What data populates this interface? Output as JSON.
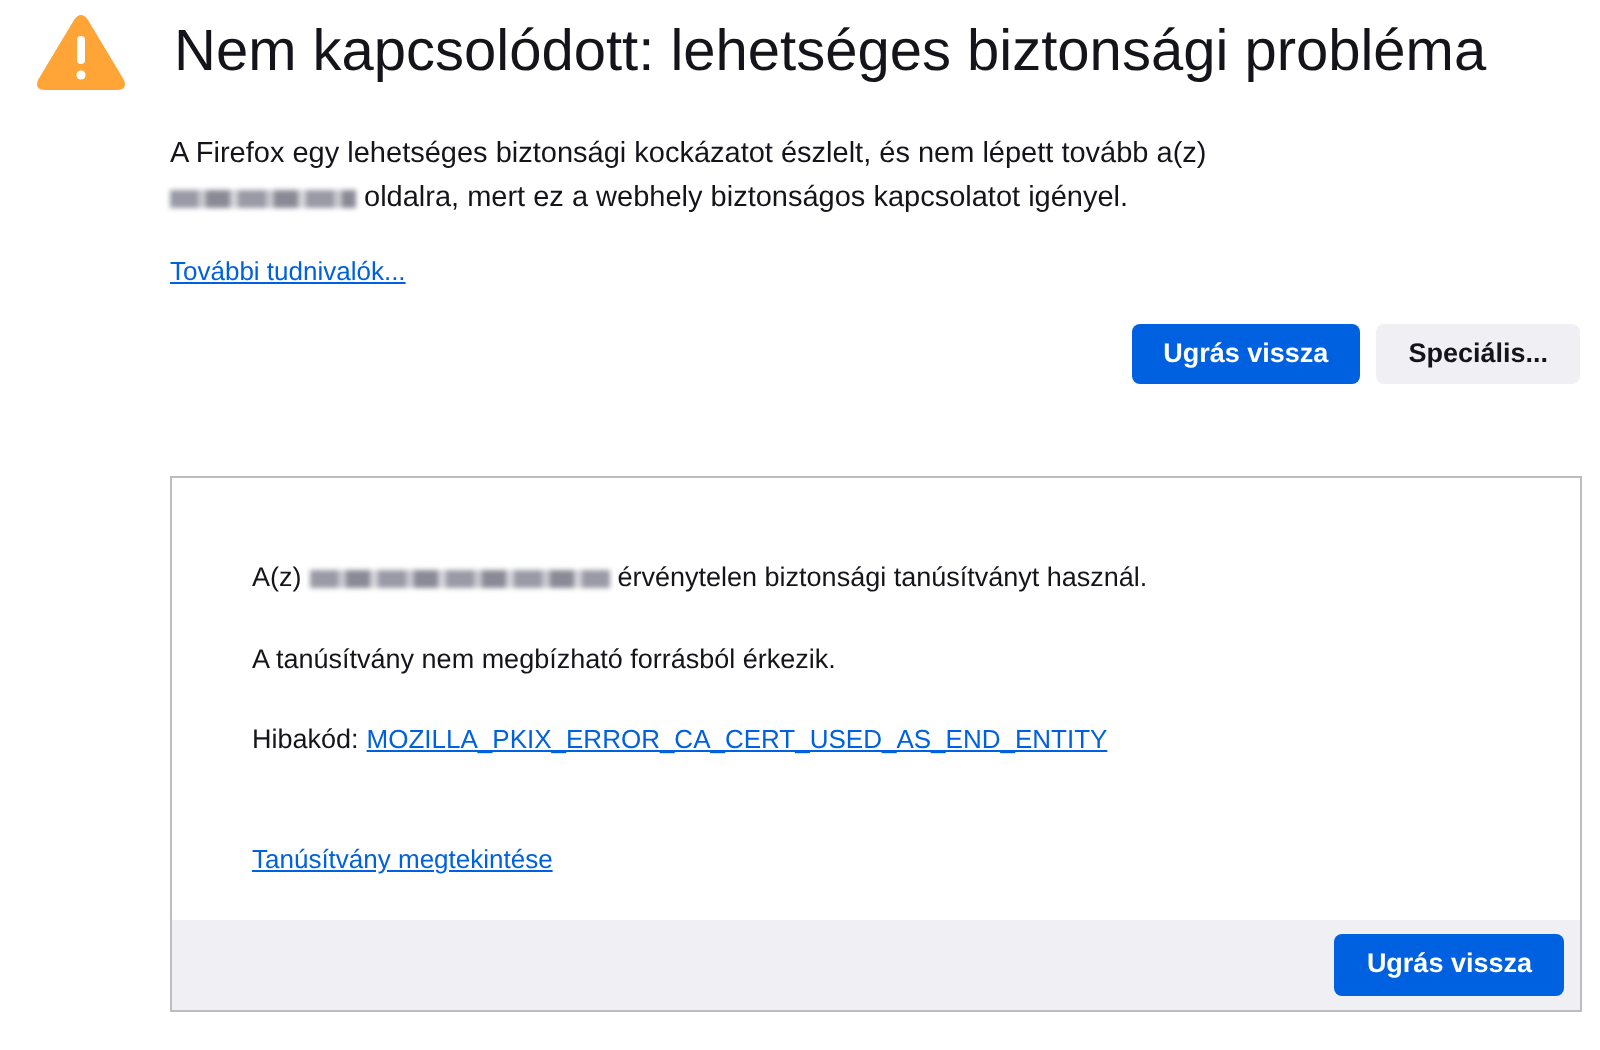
{
  "title": "Nem kapcsolódott: lehetséges biztonsági probléma",
  "intro": {
    "line_1": "A Firefox egy lehetséges biztonsági kockázatot észlelt, és nem lépett tovább a(z)",
    "line_2_rest": "oldalra, mert ez a webhely biztonságos kapcsolatot igényel."
  },
  "learn_more_link": "További tudnivalók...",
  "buttons": [
    {
      "label": "Ugrás vissza",
      "kind": "primary"
    },
    {
      "label": "Speciális...",
      "kind": "secondary"
    }
  ],
  "advanced_panel": {
    "line_1_prefix": "A(z)",
    "line_1_rest": "érvénytelen biztonsági tanúsítványt használ.",
    "line_2": "A tanúsítvány nem megbízható forrásból érkezik.",
    "error_label": "Hibakód:",
    "error_code": "MOZILLA_PKIX_ERROR_CA_CERT_USED_AS_END_ENTITY",
    "view_certificate_link": "Tanúsítvány megtekintése",
    "footer_button": {
      "label": "Ugrás vissza",
      "kind": "primary"
    }
  }
}
